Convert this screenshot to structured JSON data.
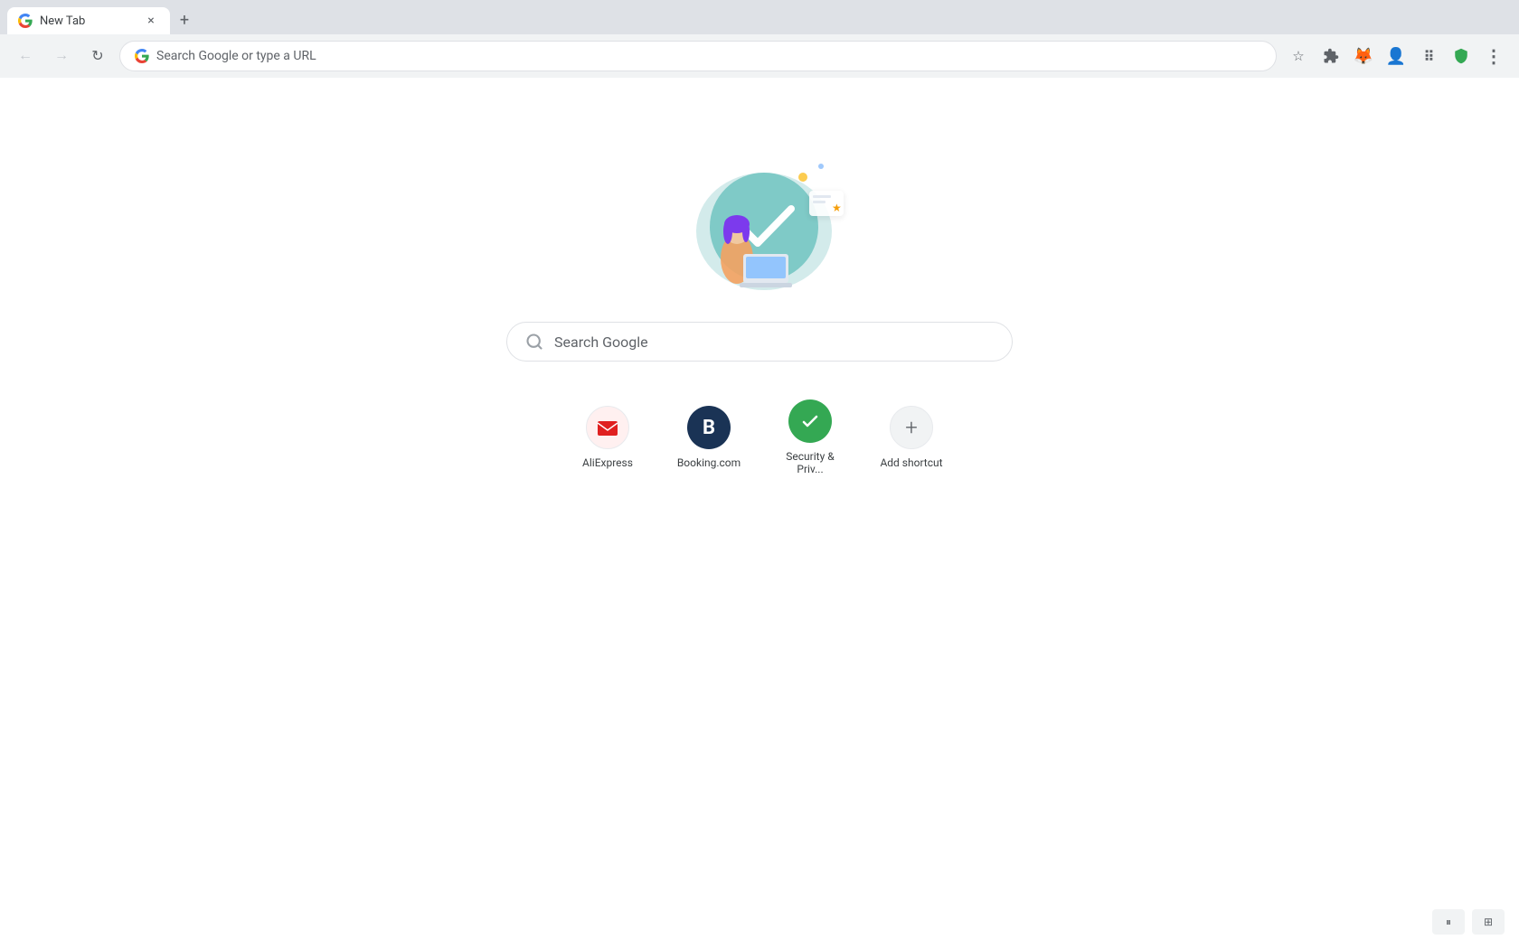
{
  "browser": {
    "tab": {
      "title": "New Tab",
      "favicon": "🌐"
    },
    "address_bar": {
      "placeholder": "Search Google or type a URL"
    }
  },
  "page": {
    "search": {
      "placeholder": "Search Google"
    },
    "shortcuts": [
      {
        "id": "aliexpress",
        "label": "AliExpress",
        "icon_type": "aliexpress",
        "icon_text": "✉"
      },
      {
        "id": "booking",
        "label": "Booking.com",
        "icon_type": "booking",
        "icon_text": "B"
      },
      {
        "id": "security",
        "label": "Security & Priv...",
        "icon_type": "security",
        "icon_text": "✓"
      },
      {
        "id": "add-shortcut",
        "label": "Add shortcut",
        "icon_type": "add",
        "icon_text": "+"
      }
    ]
  },
  "toolbar": {
    "bookmark_icon": "☆",
    "extensions_icon": "🧩",
    "profile_icon": "🦊",
    "more_icon": "⋮"
  }
}
